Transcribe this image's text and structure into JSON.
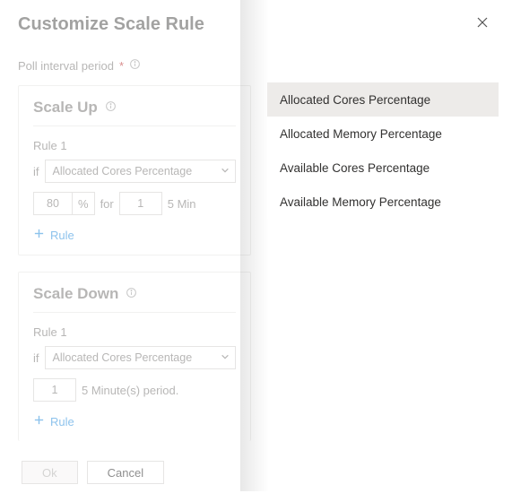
{
  "title": "Customize Scale Rule",
  "poll_label": "Poll interval period",
  "required_mark": "*",
  "sections": {
    "up": {
      "title": "Scale Up",
      "rule_label": "Rule 1",
      "if_label": "if",
      "dropdown_value": "Allocated Cores Percentage",
      "threshold": "80",
      "pct": "%",
      "for_label": "for",
      "period": "1",
      "period_text": "5 Min",
      "add": "Rule"
    },
    "down": {
      "title": "Scale Down",
      "rule_label": "Rule 1",
      "if_label": "if",
      "dropdown_value": "Allocated Cores Percentage",
      "period": "1",
      "period_text": "5 Minute(s) period.",
      "add": "Rule"
    }
  },
  "buttons": {
    "ok": "Ok",
    "cancel": "Cancel"
  },
  "menu": {
    "opt1": "Allocated Cores Percentage",
    "opt2": "Allocated Memory Percentage",
    "opt3": "Available Cores Percentage",
    "opt4": "Available Memory Percentage"
  }
}
